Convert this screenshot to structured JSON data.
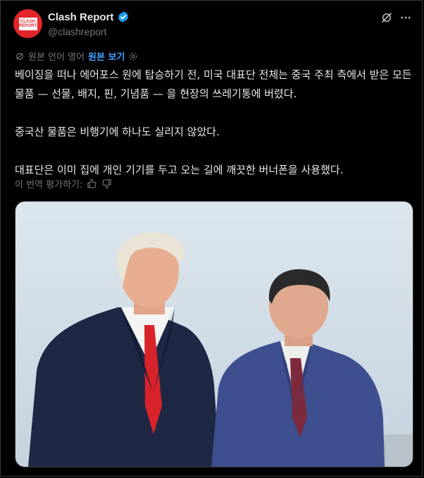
{
  "author": {
    "name": "Clash Report",
    "handle": "@clashreport",
    "logo_line1": "CLASH",
    "logo_line2": "REPORT"
  },
  "translation": {
    "note": "원본 언어 영어",
    "show_original": "원본 보기"
  },
  "post": {
    "paragraph1": "베이징을 떠나 에어포스 원에 탑승하기 전, 미국 대표단 전체는 중국 주최 측에서 받은 모든 물품 — 선물, 배지, 핀, 기념품 — 을 현장의 쓰레기통에 버렸다.",
    "paragraph2": "중국산 물품은 비행기에 하나도 실리지 않았다.",
    "paragraph3": "대표단은 이미 집에 개인 기기를 두고 오는 길에 깨끗한 버너폰을 사용했다."
  },
  "feedback": {
    "label": "이 번역 평가하기:"
  },
  "icons": {
    "verified": "verified-badge-icon",
    "grok": "grok-icon",
    "more": "more-icon",
    "translate": "translate-icon",
    "settings": "gear-icon",
    "thumbs_up": "thumbs-up-icon",
    "thumbs_down": "thumbs-down-icon"
  },
  "colors": {
    "background": "#000000",
    "text": "#e7e9ea",
    "secondary": "#71767b",
    "link": "#3ea1ff",
    "verified": "#1d9bf0",
    "brand_red": "#e3252a"
  }
}
